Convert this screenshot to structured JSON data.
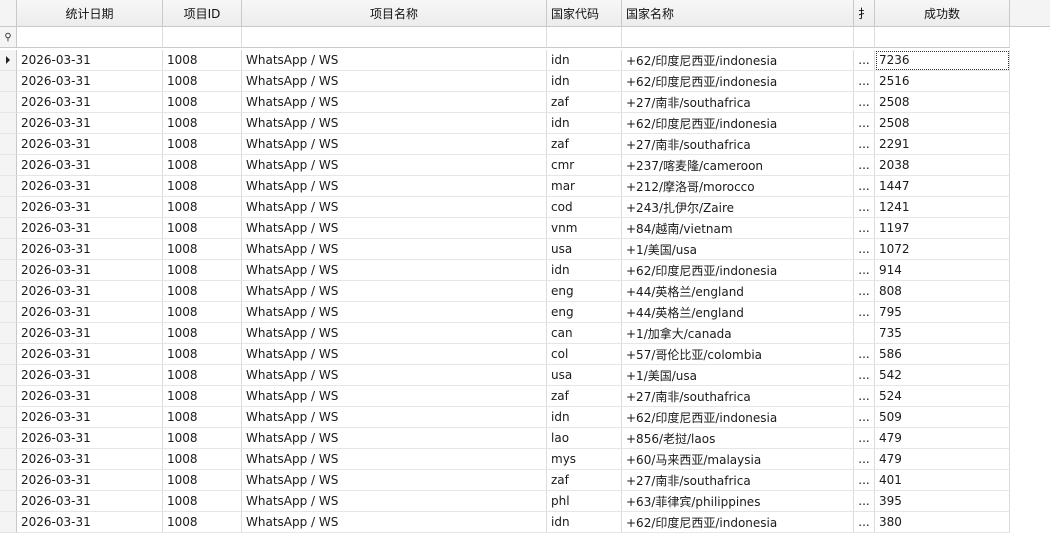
{
  "columns": [
    {
      "label": "统计日期"
    },
    {
      "label": "项目ID"
    },
    {
      "label": "项目名称"
    },
    {
      "label": "国家代码"
    },
    {
      "label": "国家名称"
    },
    {
      "label": "扌"
    },
    {
      "label": "成功数"
    }
  ],
  "filter_row": {
    "icon": "filter-icon"
  },
  "current_row_index": 0,
  "rows": [
    {
      "date": "2026-03-31",
      "pid": "1008",
      "pname": "WhatsApp / WS",
      "ccode": "idn",
      "cname": "+62/印度尼西亚/indonesia",
      "trunc": "...",
      "success": "7236"
    },
    {
      "date": "2026-03-31",
      "pid": "1008",
      "pname": "WhatsApp / WS",
      "ccode": "idn",
      "cname": "+62/印度尼西亚/indonesia",
      "trunc": "...",
      "success": "2516"
    },
    {
      "date": "2026-03-31",
      "pid": "1008",
      "pname": "WhatsApp / WS",
      "ccode": "zaf",
      "cname": "+27/南非/southafrica",
      "trunc": "...",
      "success": "2508"
    },
    {
      "date": "2026-03-31",
      "pid": "1008",
      "pname": "WhatsApp / WS",
      "ccode": "idn",
      "cname": "+62/印度尼西亚/indonesia",
      "trunc": "...",
      "success": "2508"
    },
    {
      "date": "2026-03-31",
      "pid": "1008",
      "pname": "WhatsApp / WS",
      "ccode": "zaf",
      "cname": "+27/南非/southafrica",
      "trunc": "...",
      "success": "2291"
    },
    {
      "date": "2026-03-31",
      "pid": "1008",
      "pname": "WhatsApp / WS",
      "ccode": "cmr",
      "cname": "+237/喀麦隆/cameroon",
      "trunc": "...",
      "success": "2038"
    },
    {
      "date": "2026-03-31",
      "pid": "1008",
      "pname": "WhatsApp / WS",
      "ccode": "mar",
      "cname": "+212/摩洛哥/morocco",
      "trunc": "...",
      "success": "1447"
    },
    {
      "date": "2026-03-31",
      "pid": "1008",
      "pname": "WhatsApp / WS",
      "ccode": "cod",
      "cname": "+243/扎伊尔/Zaire",
      "trunc": "...",
      "success": "1241"
    },
    {
      "date": "2026-03-31",
      "pid": "1008",
      "pname": "WhatsApp / WS",
      "ccode": "vnm",
      "cname": "+84/越南/vietnam",
      "trunc": "...",
      "success": "1197"
    },
    {
      "date": "2026-03-31",
      "pid": "1008",
      "pname": "WhatsApp / WS",
      "ccode": "usa",
      "cname": "+1/美国/usa",
      "trunc": "...",
      "success": "1072"
    },
    {
      "date": "2026-03-31",
      "pid": "1008",
      "pname": "WhatsApp / WS",
      "ccode": "idn",
      "cname": "+62/印度尼西亚/indonesia",
      "trunc": "...",
      "success": "914"
    },
    {
      "date": "2026-03-31",
      "pid": "1008",
      "pname": "WhatsApp / WS",
      "ccode": "eng",
      "cname": "+44/英格兰/england",
      "trunc": "...",
      "success": "808"
    },
    {
      "date": "2026-03-31",
      "pid": "1008",
      "pname": "WhatsApp / WS",
      "ccode": "eng",
      "cname": "+44/英格兰/england",
      "trunc": "...",
      "success": "795"
    },
    {
      "date": "2026-03-31",
      "pid": "1008",
      "pname": "WhatsApp / WS",
      "ccode": "can",
      "cname": "+1/加拿大/canada",
      "trunc": "",
      "success": "735"
    },
    {
      "date": "2026-03-31",
      "pid": "1008",
      "pname": "WhatsApp / WS",
      "ccode": "col",
      "cname": "+57/哥伦比亚/colombia",
      "trunc": "...",
      "success": "586"
    },
    {
      "date": "2026-03-31",
      "pid": "1008",
      "pname": "WhatsApp / WS",
      "ccode": "usa",
      "cname": "+1/美国/usa",
      "trunc": "...",
      "success": "542"
    },
    {
      "date": "2026-03-31",
      "pid": "1008",
      "pname": "WhatsApp / WS",
      "ccode": "zaf",
      "cname": "+27/南非/southafrica",
      "trunc": "...",
      "success": "524"
    },
    {
      "date": "2026-03-31",
      "pid": "1008",
      "pname": "WhatsApp / WS",
      "ccode": "idn",
      "cname": "+62/印度尼西亚/indonesia",
      "trunc": "...",
      "success": "509"
    },
    {
      "date": "2026-03-31",
      "pid": "1008",
      "pname": "WhatsApp / WS",
      "ccode": "lao",
      "cname": "+856/老挝/laos",
      "trunc": "...",
      "success": "479"
    },
    {
      "date": "2026-03-31",
      "pid": "1008",
      "pname": "WhatsApp / WS",
      "ccode": "mys",
      "cname": "+60/马来西亚/malaysia",
      "trunc": "...",
      "success": "479"
    },
    {
      "date": "2026-03-31",
      "pid": "1008",
      "pname": "WhatsApp / WS",
      "ccode": "zaf",
      "cname": "+27/南非/southafrica",
      "trunc": "...",
      "success": "401"
    },
    {
      "date": "2026-03-31",
      "pid": "1008",
      "pname": "WhatsApp / WS",
      "ccode": "phl",
      "cname": "+63/菲律宾/philippines",
      "trunc": "...",
      "success": "395"
    },
    {
      "date": "2026-03-31",
      "pid": "1008",
      "pname": "WhatsApp / WS",
      "ccode": "idn",
      "cname": "+62/印度尼西亚/indonesia",
      "trunc": "...",
      "success": "380"
    }
  ]
}
